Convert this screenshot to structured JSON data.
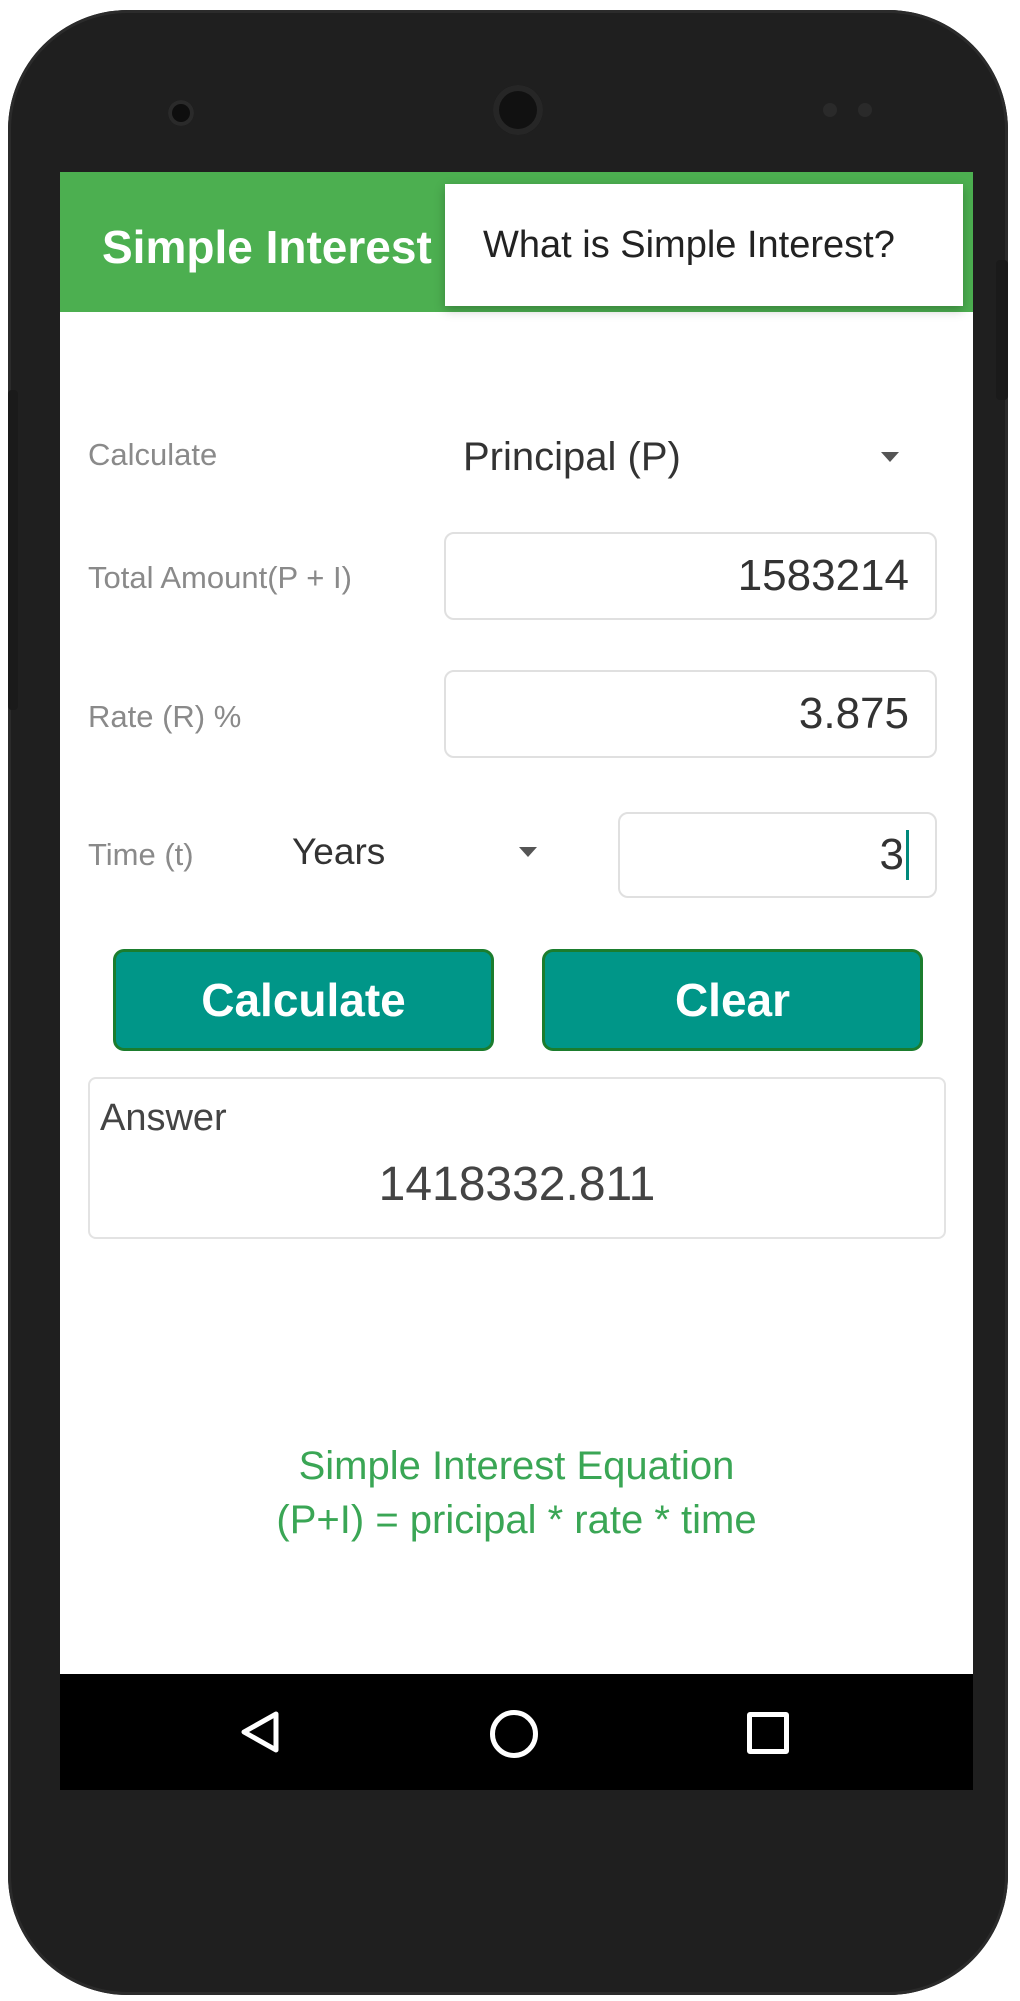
{
  "app": {
    "title": "Simple Interest",
    "menu_item": "What is Simple Interest?"
  },
  "form": {
    "calculate_label": "Calculate",
    "calculate_selected": "Principal (P)",
    "total_amount_label": "Total Amount(P + I)",
    "total_amount_value": "1583214",
    "rate_label": "Rate (R) %",
    "rate_value": "3.875",
    "time_label": "Time (t)",
    "time_unit_selected": "Years",
    "time_value": "3"
  },
  "buttons": {
    "calculate": "Calculate",
    "clear": "Clear"
  },
  "answer": {
    "label": "Answer",
    "value": "1418332.811"
  },
  "equation": {
    "line1": "Simple Interest Equation",
    "line2": "(P+I) = pricipal * rate * time"
  },
  "colors": {
    "appbar": "#4caf50",
    "button": "#009688",
    "equation_text": "#3aa655"
  },
  "icons": {
    "back": "triangle-back-icon",
    "home": "circle-home-icon",
    "recent": "square-recent-icon"
  }
}
